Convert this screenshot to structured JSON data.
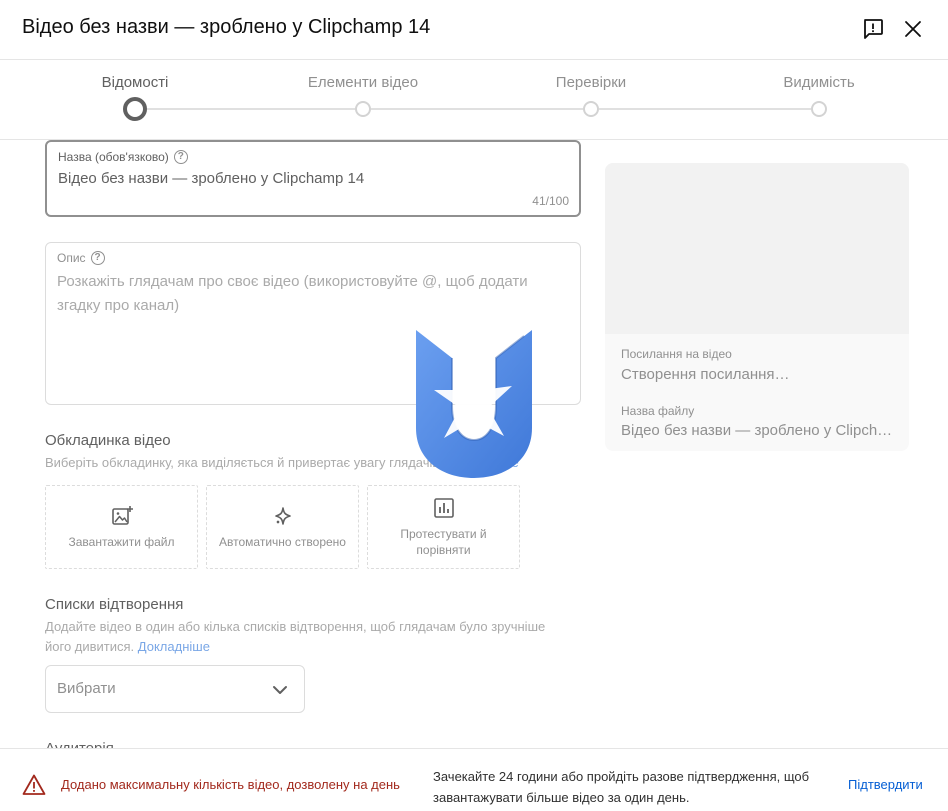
{
  "header": {
    "title": "Відео без назви — зроблено у Clipchamp 14"
  },
  "stepper": {
    "steps": [
      {
        "label": "Відомості",
        "active": true
      },
      {
        "label": "Елементи відео",
        "active": false
      },
      {
        "label": "Перевірки",
        "active": false
      },
      {
        "label": "Видимість",
        "active": false
      }
    ]
  },
  "form": {
    "title_field": {
      "label": "Назва (обов'язково)",
      "value": "Відео без назви — зроблено у Clipchamp 14",
      "counter": "41/100"
    },
    "description_field": {
      "label": "Опис",
      "placeholder": "Розкажіть глядачам про своє відео (використовуйте @, щоб додати згадку про канал)"
    },
    "thumbnail": {
      "title": "Обкладинка відео",
      "description": "Виберіть обкладинку, яка виділяється й привертає увагу глядачів.",
      "learn_more": "Докладніше",
      "options": [
        {
          "label": "Завантажити файл",
          "icon": "add-photo-icon"
        },
        {
          "label": "Автоматично створено",
          "icon": "sparkle-icon"
        },
        {
          "label": "Протестувати й порівняти",
          "icon": "bar-chart-icon"
        }
      ]
    },
    "playlists": {
      "title": "Списки відтворення",
      "description": "Додайте відео в один або кілька списків відтворення, щоб глядачам було зручніше його дивитися.",
      "learn_more": "Докладніше",
      "select_value": "Вибрати"
    },
    "audience_title": "Аудиторія"
  },
  "preview": {
    "link_label": "Посилання на відео",
    "link_value": "Створення посилання…",
    "filename_label": "Назва файлу",
    "filename_value": "Відео без назви — зроблено у Clipchamp 14"
  },
  "footer": {
    "warning": "Додано максимальну кількість відео, дозволену на день",
    "info": "Зачекайте 24 години або пройдіть разове підтвердження, щоб завантажувати більше відео за один день.",
    "confirm_label": "Підтвердити"
  },
  "colors": {
    "warning": "#a2291d",
    "link": "#065fd4",
    "logo": "#4a86e8"
  }
}
